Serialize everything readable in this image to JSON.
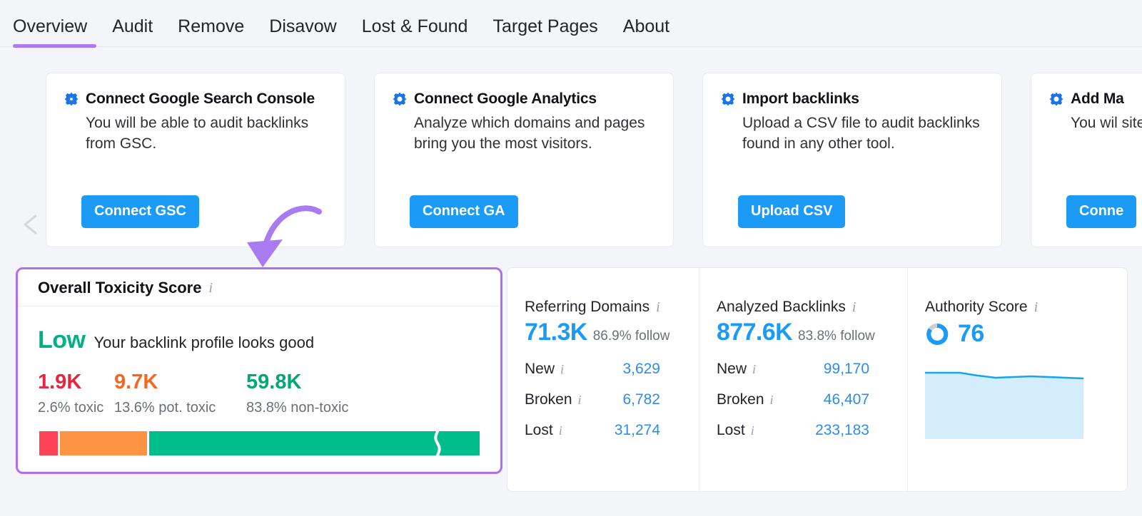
{
  "nav": {
    "tabs": [
      {
        "label": "Overview",
        "active": true
      },
      {
        "label": "Audit",
        "active": false
      },
      {
        "label": "Remove",
        "active": false
      },
      {
        "label": "Disavow",
        "active": false
      },
      {
        "label": "Lost & Found",
        "active": false
      },
      {
        "label": "Target Pages",
        "active": false
      },
      {
        "label": "About",
        "active": false
      }
    ],
    "active_underline_color": "#a97bf0"
  },
  "carousel": {
    "prev_icon": "chevron-left-icon",
    "next_icon": "chevron-right-icon",
    "cards": [
      {
        "icon": "gear-icon",
        "title": "Connect Google Search Console",
        "description": "You will be able to audit backlinks from GSC.",
        "button": "Connect GSC"
      },
      {
        "icon": "gear-icon",
        "title": "Connect Google Analytics",
        "description": "Analyze which domains and pages bring you the most visitors.",
        "button": "Connect GA"
      },
      {
        "icon": "gear-icon",
        "title": "Import backlinks",
        "description": "Upload a CSV file to audit backlinks found in any other tool.",
        "button": "Upload CSV"
      },
      {
        "icon": "gear-icon",
        "title": "Add Ma",
        "description": "You wil site ow",
        "button": "Conne"
      }
    ]
  },
  "toxicity": {
    "title": "Overall Toxicity Score",
    "info_icon": "info-icon",
    "verdict": "Low",
    "verdict_sub": "Your backlink profile looks good",
    "highlight_color": "#ac71f0",
    "stats": [
      {
        "value": "1.9K",
        "label": "2.6% toxic",
        "color": "#e8253f",
        "percent": 2.6
      },
      {
        "value": "9.7K",
        "label": "13.6% pot. toxic",
        "color": "#f4671f",
        "percent": 13.6
      },
      {
        "value": "59.8K",
        "label": "83.8% non-toxic",
        "color": "#00a878",
        "percent": 83.8
      }
    ],
    "bar_colors": [
      "#ff4256",
      "#ff9344",
      "#00be8c"
    ]
  },
  "metrics": {
    "referring_domains": {
      "title": "Referring Domains",
      "value": "71.3K",
      "follow": "86.9% follow",
      "rows": [
        {
          "label": "New",
          "value": "3,629"
        },
        {
          "label": "Broken",
          "value": "6,782"
        },
        {
          "label": "Lost",
          "value": "31,274"
        }
      ]
    },
    "analyzed_backlinks": {
      "title": "Analyzed Backlinks",
      "value": "877.6K",
      "follow": "83.8% follow",
      "rows": [
        {
          "label": "New",
          "value": "99,170"
        },
        {
          "label": "Broken",
          "value": "46,407"
        },
        {
          "label": "Lost",
          "value": "233,183"
        }
      ]
    },
    "authority_score": {
      "title": "Authority Score",
      "value": "76",
      "donut_icon": "donut-progress-icon",
      "donut_percent": 76,
      "sparkline": {
        "type": "area",
        "color": "#14a5f0",
        "fill": "#d4edfc",
        "values": [
          76,
          76,
          76,
          75.8,
          75.6,
          75.6,
          75.7,
          75.6,
          75.5,
          75.5
        ]
      }
    }
  },
  "annotation": {
    "arrow_icon": "curved-arrow-icon",
    "color": "#a97bf0"
  }
}
